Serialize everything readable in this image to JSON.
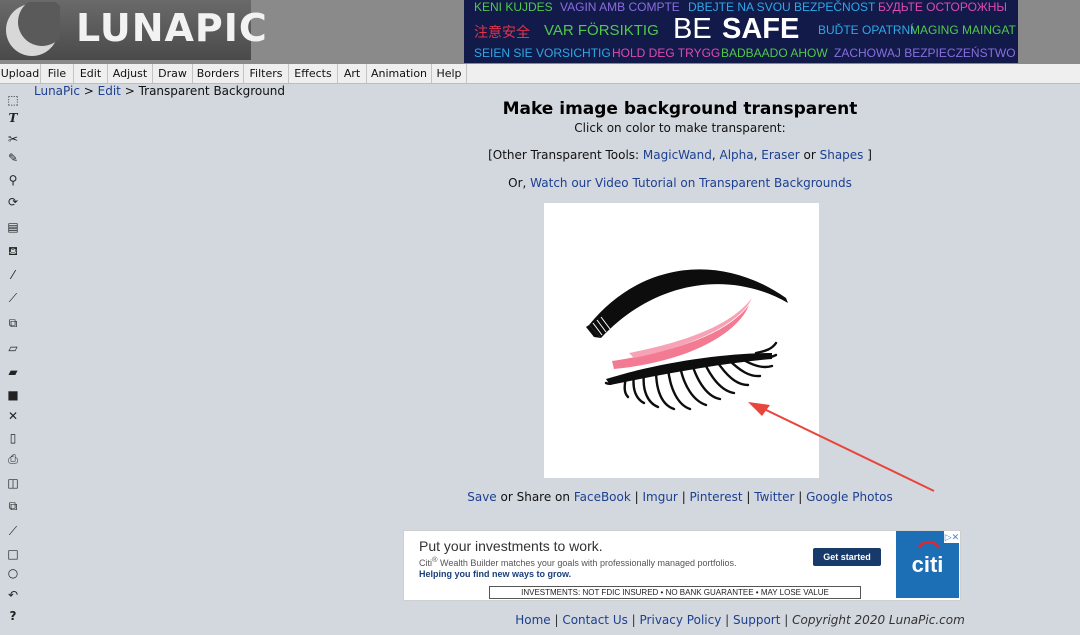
{
  "header": {
    "logo_text": "LUNAPIC",
    "banner": [
      {
        "text": "KENI KUJDES",
        "color": "#52c84a"
      },
      {
        "text": "VAGIN AMB COMPTE",
        "color": "#8a6ee0"
      },
      {
        "text": "DBEJTE NA SVOU BEZPEČNOST",
        "color": "#2ea8e6"
      },
      {
        "text": "БУДЬТЕ ОСТОРОЖНЫ",
        "color": "#e04ab0"
      },
      {
        "text": "注意安全",
        "color": "#e0344a"
      },
      {
        "text": "VAR FÖRSIKTIG",
        "color": "#52c84a"
      },
      {
        "text": "BE",
        "color": "#ffffff"
      },
      {
        "text": "SAFE",
        "color": "#ffffff"
      },
      {
        "text": "BUĎTE OPATRNÍ",
        "color": "#2ea8e6"
      },
      {
        "text": "MAGING MAINGAT",
        "color": "#52c84a"
      },
      {
        "text": "SEIEN SIE VORSICHTIG",
        "color": "#2ea8e6"
      },
      {
        "text": "HOLD DEG TRYGG",
        "color": "#e04ab0"
      },
      {
        "text": "BADBAADO AHOW",
        "color": "#52c84a"
      },
      {
        "text": "ZACHOWAJ BEZPIECZEŃSTWO",
        "color": "#8a6ee0"
      }
    ]
  },
  "menu": [
    "Upload",
    "File",
    "Edit",
    "Adjust",
    "Draw",
    "Borders",
    "Filters",
    "Effects",
    "Art",
    "Animation",
    "Help"
  ],
  "toolbar_icons": [
    "marquee-select-icon",
    "text-icon",
    "scissors-icon",
    "pencil-icon",
    "zoom-icon",
    "rotate-icon",
    "gradient-icon",
    "paint-bucket-icon",
    "eyedropper-icon",
    "brush-icon",
    "crop-icon",
    "eraser-icon",
    "open-folder-icon",
    "save-disk-icon",
    "close-icon",
    "new-page-icon",
    "print-icon",
    "layers-icon",
    "copy-icon",
    "line-icon",
    "rectangle-icon",
    "circle-icon",
    "undo-icon",
    "help-icon"
  ],
  "breadcrumb": {
    "root": "LunaPic",
    "sep1": " > ",
    "section": "Edit",
    "sep2": " > ",
    "current": "Transparent Background"
  },
  "main": {
    "title": "Make image background transparent",
    "instruction": "Click on color to make transparent:",
    "other_tools_prefix": "[Other Transparent Tools: ",
    "tools": [
      "MagicWand",
      "Alpha",
      "Eraser",
      "Shapes"
    ],
    "comma": ", ",
    "or_word": " or ",
    "other_tools_suffix": " ]",
    "video_prefix": "Or, ",
    "video_link": "Watch our Video Tutorial on Transparent Backgrounds"
  },
  "share": {
    "save": "Save",
    "or_share_on": " or Share on ",
    "targets": [
      "FaceBook",
      "Imgur",
      "Pinterest",
      "Twitter",
      "Google Photos"
    ],
    "sep": " | "
  },
  "ad": {
    "headline": "Put your investments to work.",
    "sub_brand": "Citi",
    "sub_mark": "®",
    "sub_text": " Wealth Builder matches your goals with professionally managed portfolios.",
    "tagline": "Helping you find new ways to grow.",
    "cta": "Get started",
    "brand": "citi",
    "close": "▷✕",
    "disclaimer": "INVESTMENTS: NOT FDIC INSURED • NO BANK GUARANTEE • MAY LOSE VALUE"
  },
  "footer": {
    "links": [
      "Home",
      "Contact Us",
      "Privacy Policy",
      "Support"
    ],
    "sep": " | ",
    "copyright_prefix": "Copyright 2020 ",
    "copyright_site": "LunaPic.com"
  },
  "colors": {
    "accent_link": "#1d3f8f",
    "eyelash_pink": "#f27a93",
    "arrow_red": "#e8453c"
  }
}
